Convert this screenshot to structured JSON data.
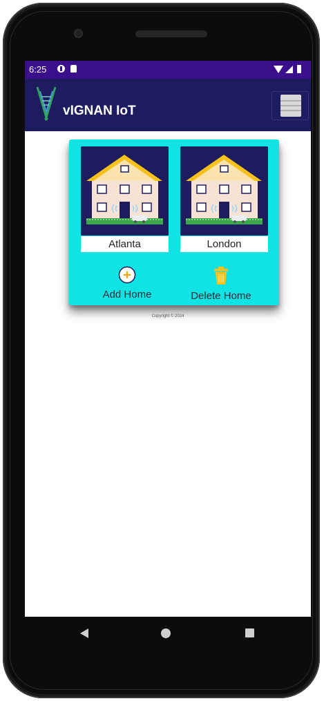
{
  "status_bar": {
    "time": "6:25",
    "left_icons": [
      "data-saver-icon",
      "sd-card-icon"
    ],
    "right_icons": [
      "wifi-icon",
      "signal-icon",
      "battery-icon"
    ],
    "background": "#3b0f8c"
  },
  "app_bar": {
    "title": "vIGNAN IoT",
    "background": "#1c1c5e",
    "menu_icon": "hamburger-menu-icon"
  },
  "homes": [
    {
      "name": "Atlanta",
      "icon": "house-icon"
    },
    {
      "name": "London",
      "icon": "house-icon"
    }
  ],
  "actions": {
    "add_label": "Add Home",
    "add_icon": "plus-circle-icon",
    "delete_label": "Delete Home",
    "delete_icon": "trash-icon"
  },
  "panel": {
    "background": "#0fe3e3"
  },
  "footer": {
    "copyright": "Copyright © 2024"
  },
  "navigation": [
    "back-icon",
    "home-icon",
    "recents-icon"
  ]
}
